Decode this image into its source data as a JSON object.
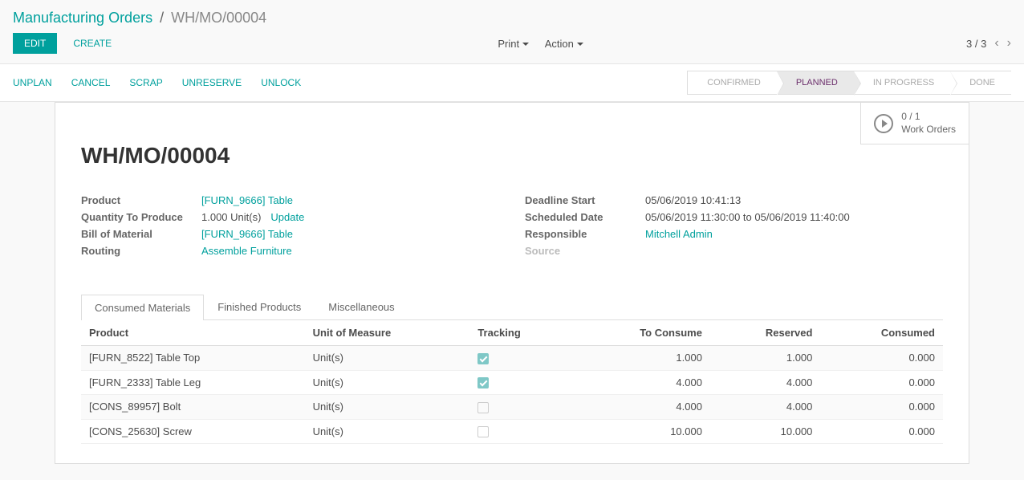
{
  "breadcrumb": {
    "parent": "Manufacturing Orders",
    "current": "WH/MO/00004"
  },
  "buttons": {
    "edit": "EDIT",
    "create": "CREATE"
  },
  "dropdowns": {
    "print": "Print",
    "action": "Action"
  },
  "pager": "3 / 3",
  "actions": {
    "unplan": "UNPLAN",
    "cancel": "CANCEL",
    "scrap": "SCRAP",
    "unreserve": "UNRESERVE",
    "unlock": "UNLOCK"
  },
  "statuses": [
    "CONFIRMED",
    "PLANNED",
    "IN PROGRESS",
    "DONE"
  ],
  "active_status_index": 1,
  "stat": {
    "count": "0 / 1",
    "label": "Work Orders"
  },
  "title": "WH/MO/00004",
  "fields_left": {
    "product_label": "Product",
    "product_value": "[FURN_9666] Table",
    "qty_label": "Quantity To Produce",
    "qty_value": "1.000 Unit(s)",
    "update": "Update",
    "bom_label": "Bill of Material",
    "bom_value": "[FURN_9666] Table",
    "routing_label": "Routing",
    "routing_value": "Assemble Furniture"
  },
  "fields_right": {
    "deadline_label": "Deadline Start",
    "deadline_value": "05/06/2019 10:41:13",
    "scheduled_label": "Scheduled Date",
    "scheduled_value": "05/06/2019 11:30:00 to 05/06/2019 11:40:00",
    "responsible_label": "Responsible",
    "responsible_value": "Mitchell Admin",
    "source_label": "Source",
    "source_value": ""
  },
  "tabs": [
    "Consumed Materials",
    "Finished Products",
    "Miscellaneous"
  ],
  "active_tab_index": 0,
  "columns": {
    "product": "Product",
    "uom": "Unit of Measure",
    "tracking": "Tracking",
    "to_consume": "To Consume",
    "reserved": "Reserved",
    "consumed": "Consumed"
  },
  "rows": [
    {
      "product": "[FURN_8522] Table Top",
      "uom": "Unit(s)",
      "tracking": true,
      "to_consume": "1.000",
      "reserved": "1.000",
      "consumed": "0.000"
    },
    {
      "product": "[FURN_2333] Table Leg",
      "uom": "Unit(s)",
      "tracking": true,
      "to_consume": "4.000",
      "reserved": "4.000",
      "consumed": "0.000"
    },
    {
      "product": "[CONS_89957] Bolt",
      "uom": "Unit(s)",
      "tracking": false,
      "to_consume": "4.000",
      "reserved": "4.000",
      "consumed": "0.000"
    },
    {
      "product": "[CONS_25630] Screw",
      "uom": "Unit(s)",
      "tracking": false,
      "to_consume": "10.000",
      "reserved": "10.000",
      "consumed": "0.000"
    }
  ]
}
